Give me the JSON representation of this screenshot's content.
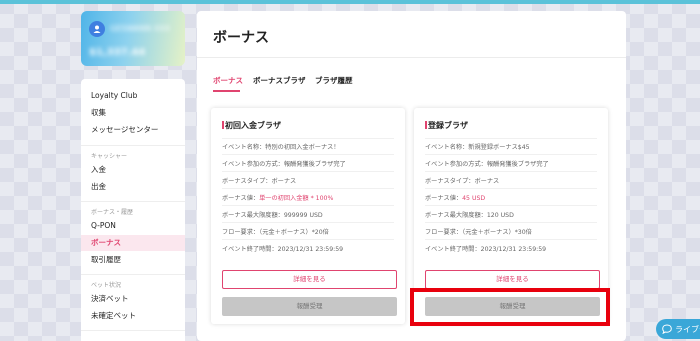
{
  "colors": {
    "accent": "#e0446f",
    "highlight": "#e8000d",
    "chat": "#3aa7d8"
  },
  "account": {
    "name": "GESWANN XXX",
    "balance": "$1,337.44"
  },
  "sidebar": {
    "items": [
      {
        "label": "Loyalty Club"
      },
      {
        "label": "収集"
      },
      {
        "label": "メッセージセンター"
      }
    ],
    "sections": [
      {
        "heading": "キャッシャー",
        "items": [
          {
            "label": "入金"
          },
          {
            "label": "出金"
          }
        ]
      },
      {
        "heading": "ボーナス・履歴",
        "items": [
          {
            "label": "Q-PON"
          },
          {
            "label": "ボーナス",
            "active": true
          },
          {
            "label": "取引履歴"
          }
        ]
      },
      {
        "heading": "ベット状況",
        "items": [
          {
            "label": "決済ベット"
          },
          {
            "label": "未確定ベット"
          }
        ]
      }
    ]
  },
  "main": {
    "title": "ボーナス",
    "tabs": [
      {
        "label": "ボーナス",
        "active": true
      },
      {
        "label": "ボーナスブラザ"
      },
      {
        "label": "ブラザ履歴"
      }
    ]
  },
  "cards": [
    {
      "title": "初回入金ブラザ",
      "rows": [
        "イベント名称：特別の初回入金ボーナス！",
        "イベント参加の方式：報酬発獲後ブラザ完了",
        "ボーナスタイプ：ボーナス",
        {
          "prefix": "ボーナス値：",
          "value": "単一の初回入金額 * 100%"
        },
        "ボーナス最大限度額：999999 USD",
        "フロー要求：（元金＋ボーナス）*20倍",
        "イベント終了時間：2023/12/31 23:59:59"
      ],
      "detail_label": "詳細を見る",
      "receive_label": "報酬受理"
    },
    {
      "title": "登録ブラザ",
      "rows": [
        "イベント名称：新規登録ボーナス$45",
        "イベント参加の方式：報酬発獲後ブラザ完了",
        "ボーナスタイプ：ボーナス",
        {
          "prefix": "ボーナス値：",
          "value": "45 USD"
        },
        "ボーナス最大限度額：120 USD",
        "フロー要求：（元金＋ボーナス）*30倍",
        "イベント終了時間：2023/12/31 23:59:59"
      ],
      "detail_label": "詳細を見る",
      "receive_label": "報酬受理"
    }
  ],
  "chat": {
    "icon": "chat-bubble-icon",
    "label": "ライブチ"
  }
}
